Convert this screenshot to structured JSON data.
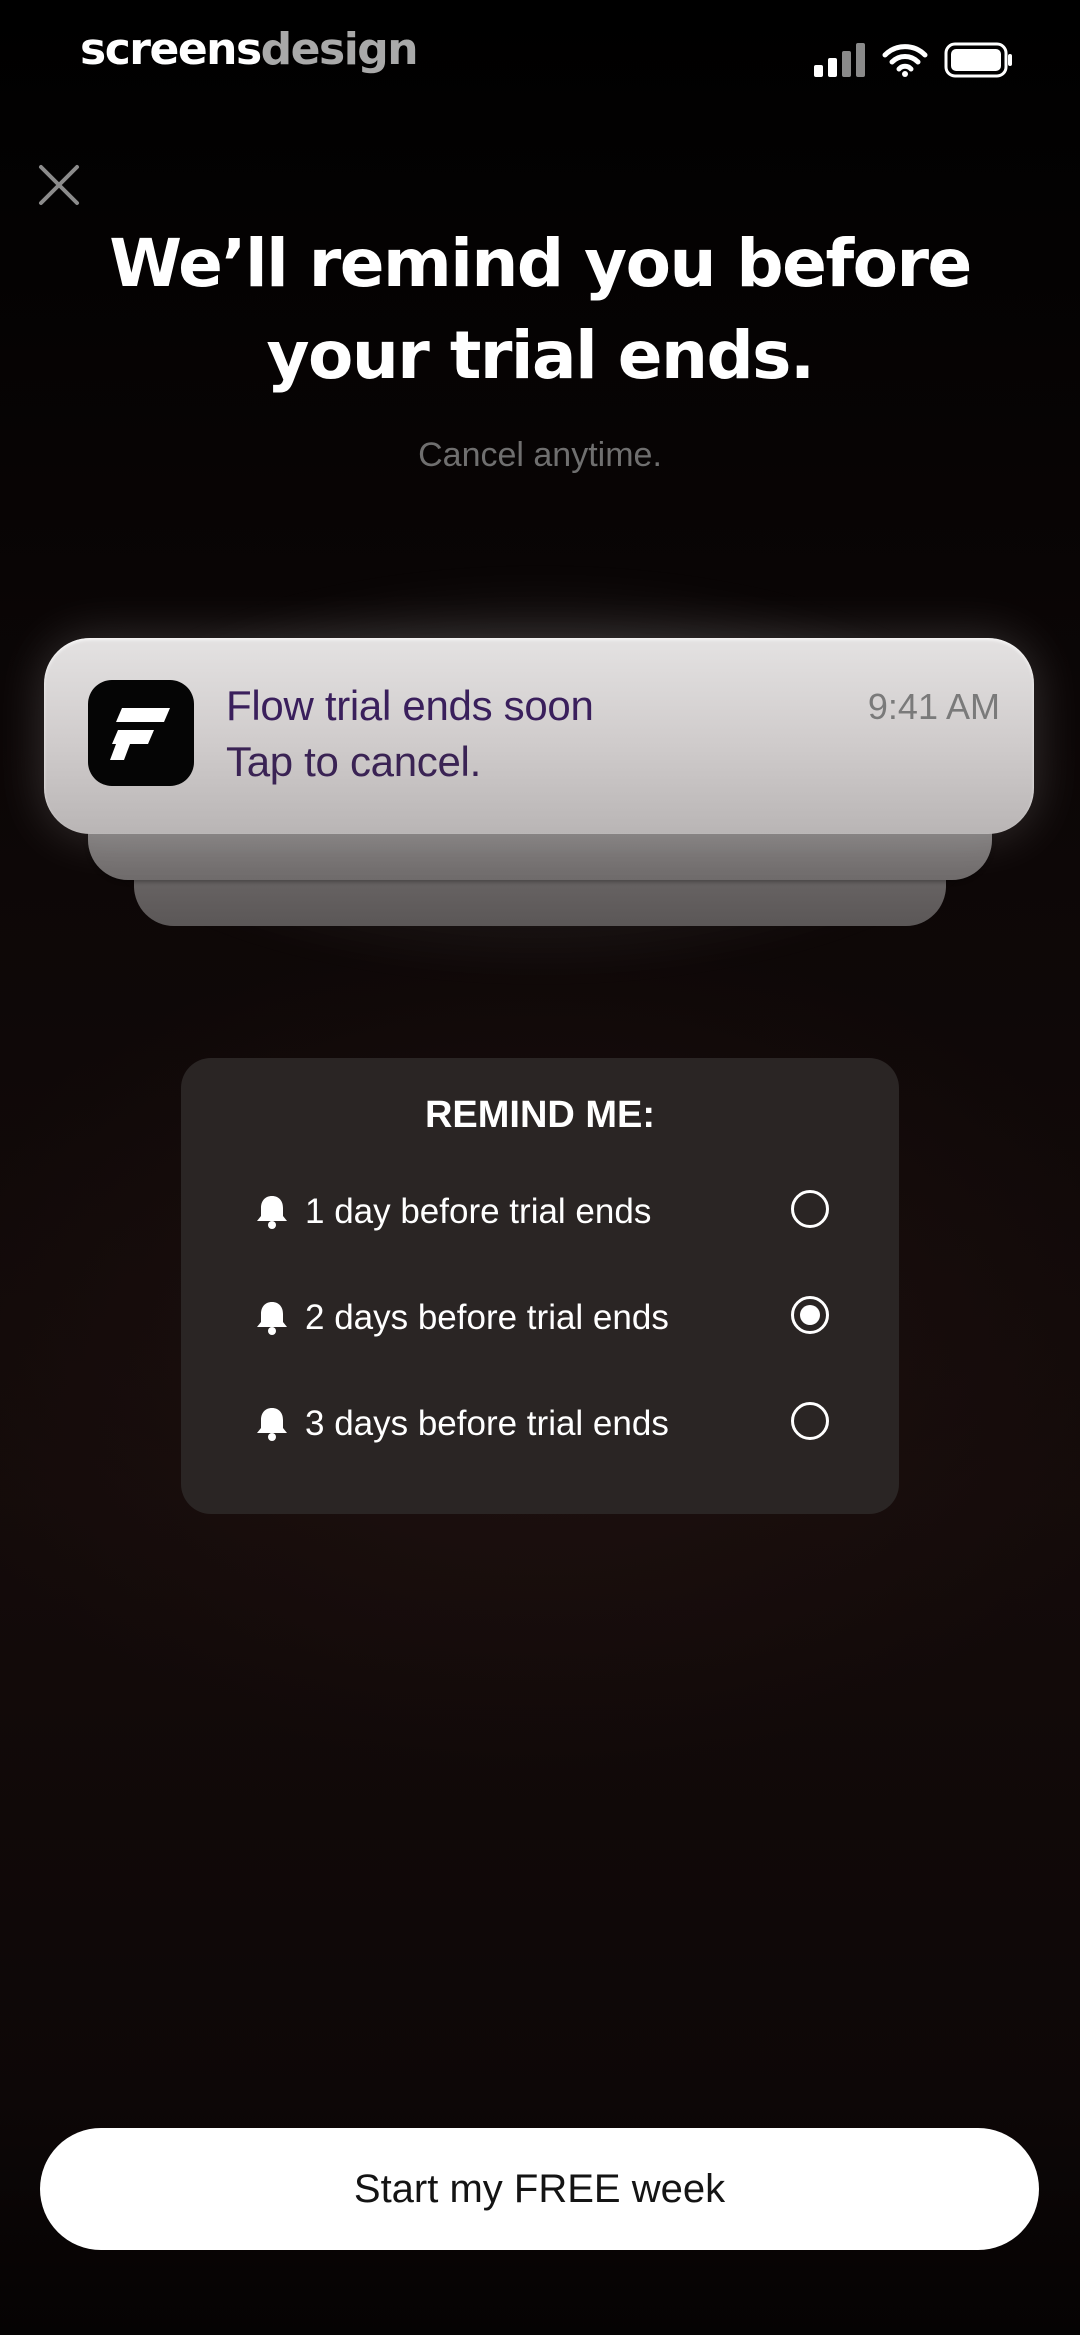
{
  "status_bar": {
    "brand_part1": "screens",
    "brand_part2": "design",
    "icons": [
      "cellular-signal-icon",
      "wifi-icon",
      "battery-icon"
    ]
  },
  "close": {
    "icon": "close-icon"
  },
  "headline": {
    "line1": "We’ll remind you before",
    "line2": "your trial ends."
  },
  "subline": "Cancel anytime.",
  "notification": {
    "app_icon": "flow-app-icon",
    "title": "Flow trial ends soon",
    "body": "Tap to cancel.",
    "time": "9:41 AM"
  },
  "reminder": {
    "title": "REMIND ME:",
    "options": [
      {
        "label": "1 day before trial ends",
        "selected": false
      },
      {
        "label": "2 days before trial ends",
        "selected": true
      },
      {
        "label": "3 days before trial ends",
        "selected": false
      }
    ]
  },
  "cta": {
    "label": "Start my FREE week"
  },
  "colors": {
    "background": "#000000",
    "panel": "#2a2524",
    "notification_title": "#3a1f5c",
    "subline": "#6f6f6f",
    "cta_background": "#ffffff"
  }
}
